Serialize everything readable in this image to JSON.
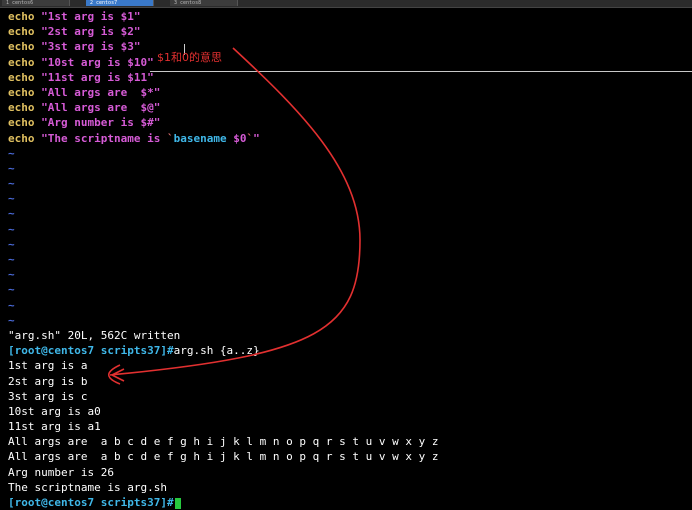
{
  "tabs": [
    {
      "label": "1 centos6"
    },
    {
      "label": "2 centos7"
    },
    {
      "label": "3 centos8"
    }
  ],
  "editor": {
    "lines": [
      {
        "kw": "echo",
        "s1": "\"1st arg is ",
        "v": "$1",
        "s2": "\""
      },
      {
        "kw": "echo",
        "s1": "\"2st arg is ",
        "v": "$2",
        "s2": "\""
      },
      {
        "kw": "echo",
        "s1": "\"3st arg is ",
        "v": "$3",
        "s2": "\""
      },
      {
        "kw": "echo",
        "s1": "\"10st arg is ",
        "v": "$10",
        "s2": "\""
      },
      {
        "kw": "echo",
        "s1": "\"11st arg is ",
        "v": "$11",
        "s2": "\""
      },
      {
        "kw": "echo",
        "s1": "\"All args are  ",
        "v": "$*",
        "s2": "\""
      },
      {
        "kw": "echo",
        "s1": "\"All args are  ",
        "v": "$@",
        "s2": "\""
      },
      {
        "kw": "echo",
        "s1": "\"Arg number is ",
        "v": "$#",
        "s2": "\""
      }
    ],
    "last": {
      "kw": "echo",
      "s1": "\"The scriptname is ",
      "bt1": "`",
      "sub": "basename ",
      "v": "$0",
      "bt2": "`",
      "s2": "\""
    },
    "tilde": "~",
    "tilde_count": 12
  },
  "status_line": "\"arg.sh\" 20L, 562C written",
  "prompt": "[root@centos7 scripts37]#",
  "command": "arg.sh {a..z}",
  "output": [
    "1st arg is a",
    "2st arg is b",
    "3st arg is c",
    "10st arg is a0",
    "11st arg is a1",
    "All args are  a b c d e f g h i j k l m n o p q r s t u v w x y z",
    "All args are  a b c d e f g h i j k l m n o p q r s t u v w x y z",
    "Arg number is 26",
    "The scriptname is arg.sh"
  ],
  "annotation": "$1和0的意思",
  "colors": {
    "annotation": "#e23030",
    "prompt": "#3fb7e8",
    "cursor": "#27c93f"
  }
}
